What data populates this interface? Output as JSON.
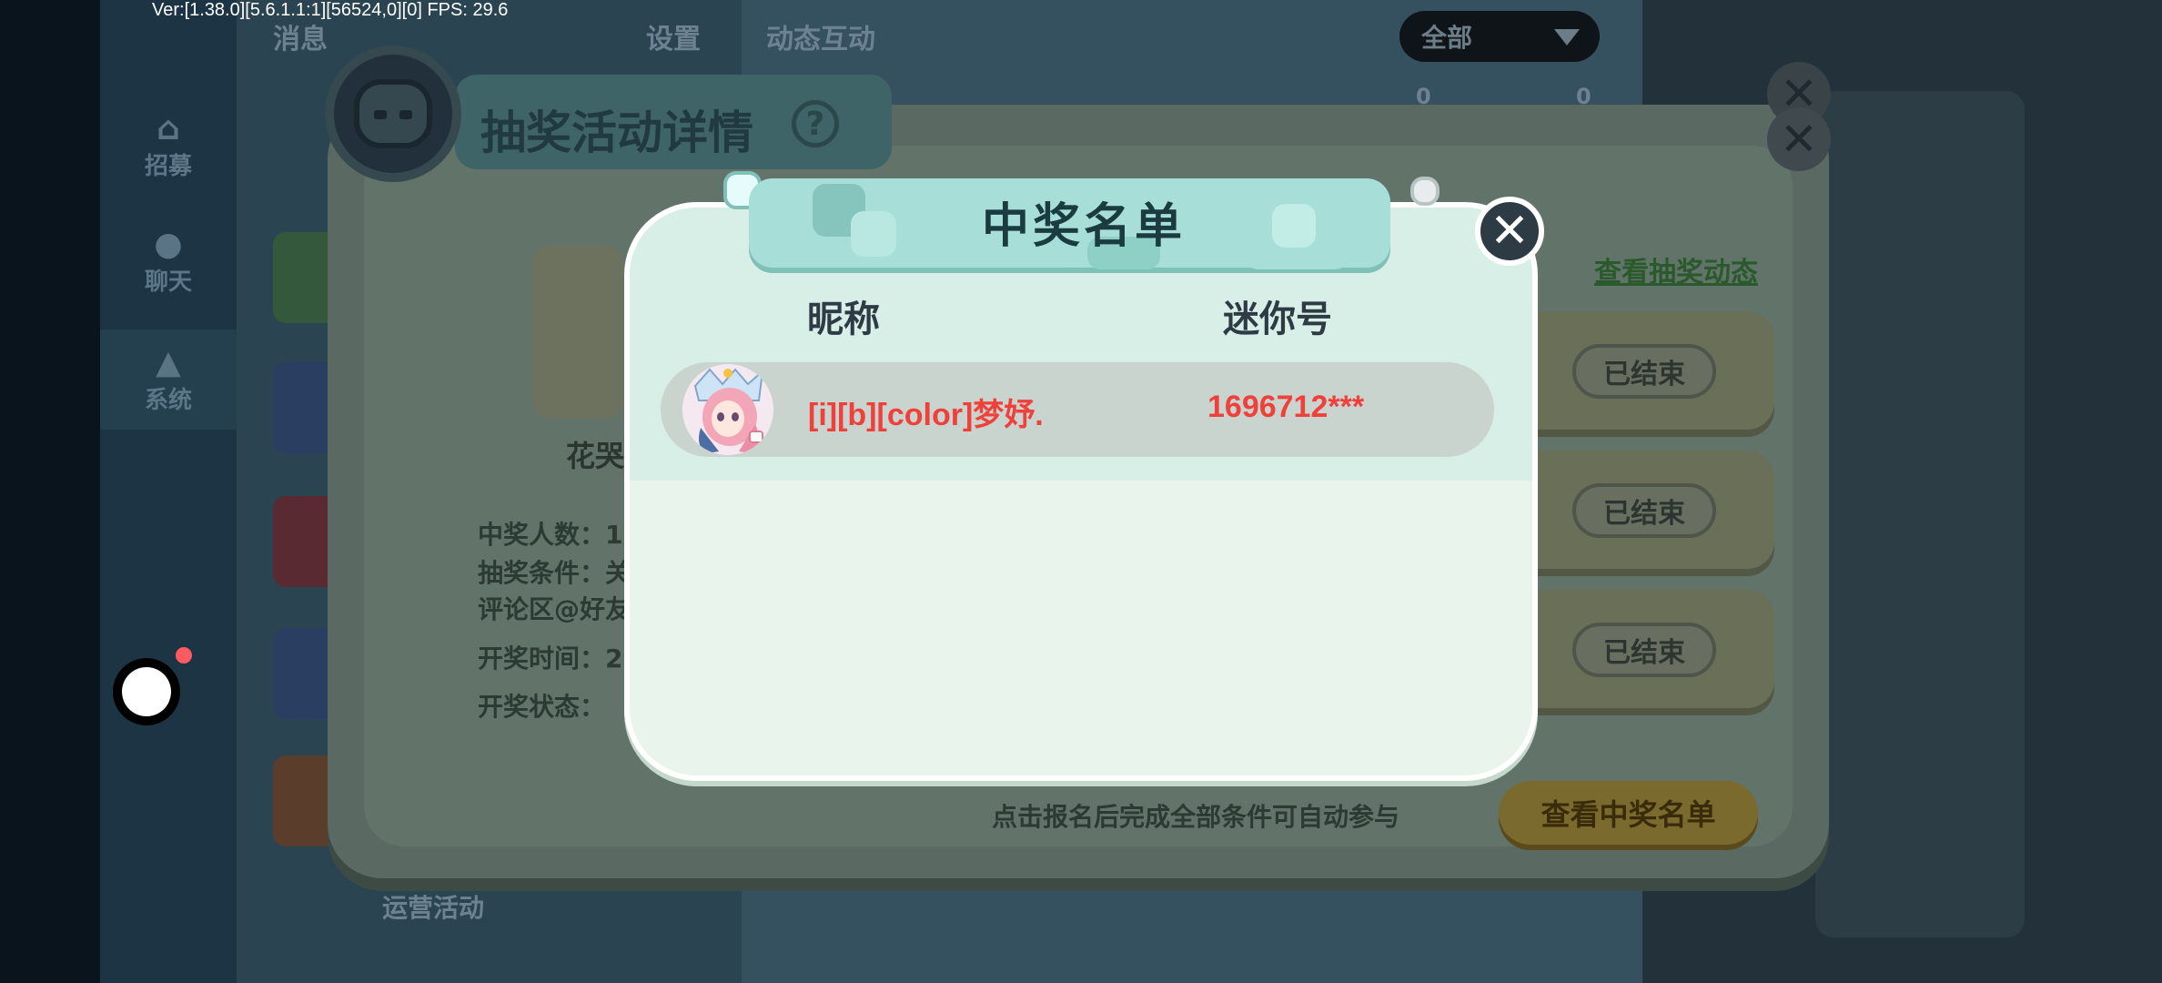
{
  "debug": {
    "version_text": "Ver:[1.38.0][5.6.1.1:1][56524,0][0] FPS: 29.6"
  },
  "background": {
    "sidebar": {
      "items": [
        {
          "label": "招募",
          "icon": "recruit-icon"
        },
        {
          "label": "聊天",
          "icon": "chat-icon"
        },
        {
          "label": "系统",
          "icon": "bell-icon"
        }
      ]
    },
    "top": {
      "left_tab": "消息",
      "settings_tab": "设置",
      "feed_tab": "动态互动",
      "filter_value": "全部"
    },
    "list_bottom_text": "运营活动",
    "stats": {
      "likes": "0",
      "shares": "0"
    }
  },
  "detail": {
    "title": "抽奖活动详情",
    "help_glyph": "?",
    "avatar_name": "花哭",
    "labels": {
      "winners_count": "中奖人数：1",
      "condition": "抽奖条件：关",
      "condition_extra": "评论区@好友",
      "draw_time": "开奖时间：2",
      "draw_status": "开奖状态："
    },
    "view_feed_link": "查看抽奖动态",
    "ended_label": "已结束",
    "hint": "点击报名后完成全部条件可自动参与",
    "view_winners_button": "查看中奖名单"
  },
  "modal": {
    "title": "中奖名单",
    "columns": {
      "nickname": "昵称",
      "mini_id": "迷你号"
    },
    "winners": [
      {
        "nickname": "[i][b][color]梦妤.",
        "mini_id": "1696712***"
      }
    ],
    "close_glyph": "✕"
  },
  "colors": {
    "winner_text": "#f0403c",
    "banner": "#a7dfd8",
    "modal_bg": "#e8f4ec"
  }
}
